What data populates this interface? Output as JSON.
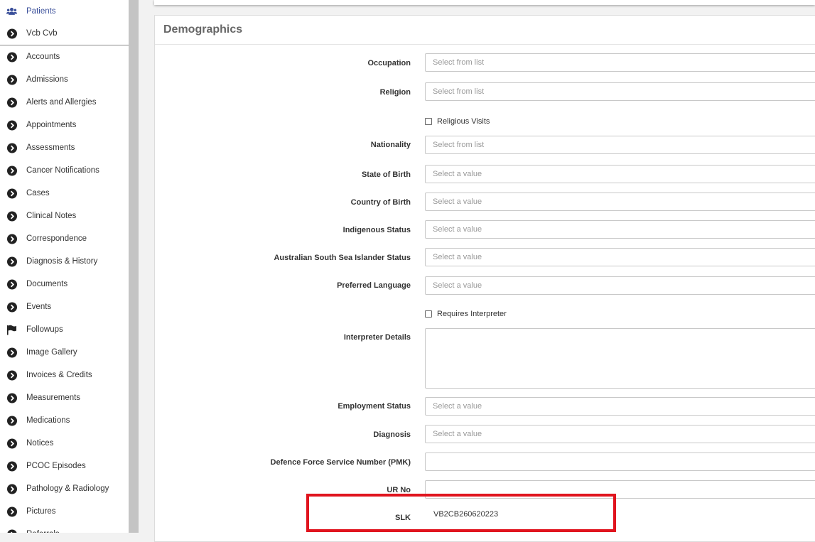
{
  "sidebar": {
    "patients": "Patients",
    "vcb": "Vcb Cvb",
    "items": [
      {
        "label": "Accounts",
        "icon": "chevron-circle-icon"
      },
      {
        "label": "Admissions",
        "icon": "chevron-circle-icon"
      },
      {
        "label": "Alerts and Allergies",
        "icon": "chevron-circle-icon"
      },
      {
        "label": "Appointments",
        "icon": "chevron-circle-icon"
      },
      {
        "label": "Assessments",
        "icon": "chevron-circle-icon"
      },
      {
        "label": "Cancer Notifications",
        "icon": "chevron-circle-icon"
      },
      {
        "label": "Cases",
        "icon": "chevron-circle-icon"
      },
      {
        "label": "Clinical Notes",
        "icon": "chevron-circle-icon"
      },
      {
        "label": "Correspondence",
        "icon": "chevron-circle-icon"
      },
      {
        "label": "Diagnosis & History",
        "icon": "chevron-circle-icon"
      },
      {
        "label": "Documents",
        "icon": "chevron-circle-icon"
      },
      {
        "label": "Events",
        "icon": "chevron-circle-icon"
      },
      {
        "label": "Followups",
        "icon": "flag-icon"
      },
      {
        "label": "Image Gallery",
        "icon": "chevron-circle-icon"
      },
      {
        "label": "Invoices & Credits",
        "icon": "chevron-circle-icon"
      },
      {
        "label": "Measurements",
        "icon": "chevron-circle-icon"
      },
      {
        "label": "Medications",
        "icon": "chevron-circle-icon"
      },
      {
        "label": "Notices",
        "icon": "chevron-circle-icon"
      },
      {
        "label": "PCOC Episodes",
        "icon": "chevron-circle-icon"
      },
      {
        "label": "Pathology & Radiology",
        "icon": "chevron-circle-icon"
      },
      {
        "label": "Pictures",
        "icon": "chevron-circle-icon"
      },
      {
        "label": "Referrals",
        "icon": "chevron-circle-icon"
      }
    ]
  },
  "panel": {
    "title": "Demographics",
    "occupation": {
      "label": "Occupation",
      "placeholder": "Select from list"
    },
    "religion": {
      "label": "Religion",
      "placeholder": "Select from list"
    },
    "religious_visits": "Religious Visits",
    "nationality": {
      "label": "Nationality",
      "placeholder": "Select from list"
    },
    "state_of_birth": {
      "label": "State of Birth",
      "placeholder": "Select a value"
    },
    "country_of_birth": {
      "label": "Country of Birth",
      "placeholder": "Select a value"
    },
    "indigenous_status": {
      "label": "Indigenous Status",
      "placeholder": "Select a value"
    },
    "assi_status": {
      "label": "Australian South Sea Islander Status",
      "placeholder": "Select a value"
    },
    "preferred_language": {
      "label": "Preferred Language",
      "placeholder": "Select a value"
    },
    "requires_interpreter": "Requires Interpreter",
    "interpreter_details": {
      "label": "Interpreter Details"
    },
    "employment_status": {
      "label": "Employment Status",
      "placeholder": "Select a value"
    },
    "diagnosis": {
      "label": "Diagnosis",
      "placeholder": "Select a value"
    },
    "defence_number": {
      "label": "Defence Force Service Number (PMK)"
    },
    "ur_no": {
      "label": "UR No"
    },
    "slk": {
      "label": "SLK",
      "value": "VB2CB260620223"
    }
  },
  "colors": {
    "highlight": "#e0141e",
    "active_nav": "#3a4f9a"
  }
}
